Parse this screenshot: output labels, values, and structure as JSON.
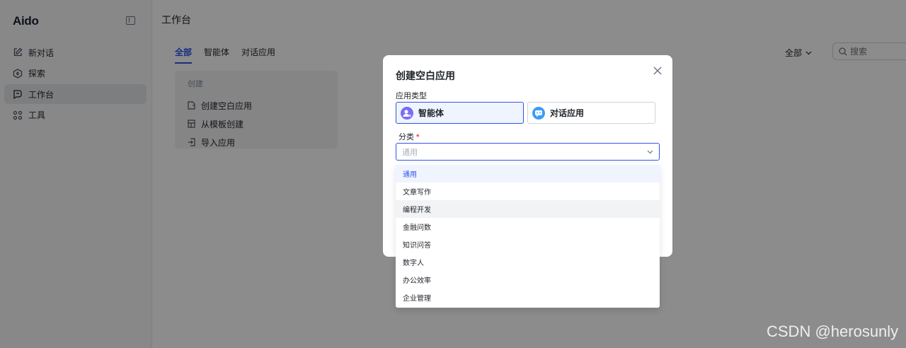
{
  "app": {
    "logo": "Aido"
  },
  "sidebar": {
    "items": [
      {
        "label": "新对话",
        "icon": "edit-icon"
      },
      {
        "label": "探索",
        "icon": "compass-icon"
      },
      {
        "label": "工作台",
        "icon": "workspace-icon",
        "active": true
      },
      {
        "label": "工具",
        "icon": "grid-icon"
      }
    ]
  },
  "header": {
    "title": "工作台"
  },
  "tabs": [
    {
      "label": "全部",
      "active": true
    },
    {
      "label": "智能体"
    },
    {
      "label": "对话应用"
    }
  ],
  "filter": {
    "label": "全部"
  },
  "search": {
    "placeholder": "搜索"
  },
  "create_card": {
    "title": "创建",
    "items": [
      {
        "label": "创建空白应用",
        "icon": "blank-file-icon"
      },
      {
        "label": "从模板创建",
        "icon": "template-icon"
      },
      {
        "label": "导入应用",
        "icon": "import-icon"
      }
    ]
  },
  "modal": {
    "title": "创建空白应用",
    "type_label": "应用类型",
    "types": [
      {
        "label": "智能体",
        "selected": true,
        "icon": "agent-icon",
        "color": "#7b6cf6"
      },
      {
        "label": "对话应用",
        "selected": false,
        "icon": "chat-icon",
        "color": "#3b9cf6"
      }
    ],
    "category_label": "分类",
    "required_mark": "*",
    "category_placeholder": "通用"
  },
  "dropdown": {
    "options": [
      "通用",
      "文章写作",
      "编程开发",
      "金融问数",
      "知识问答",
      "数字人",
      "办公效率",
      "企业管理"
    ],
    "selected_index": 0,
    "hovered_index": 2
  },
  "watermark": "CSDN @herosunly",
  "colors": {
    "accent": "#2f54eb",
    "required": "#f53f3f"
  }
}
